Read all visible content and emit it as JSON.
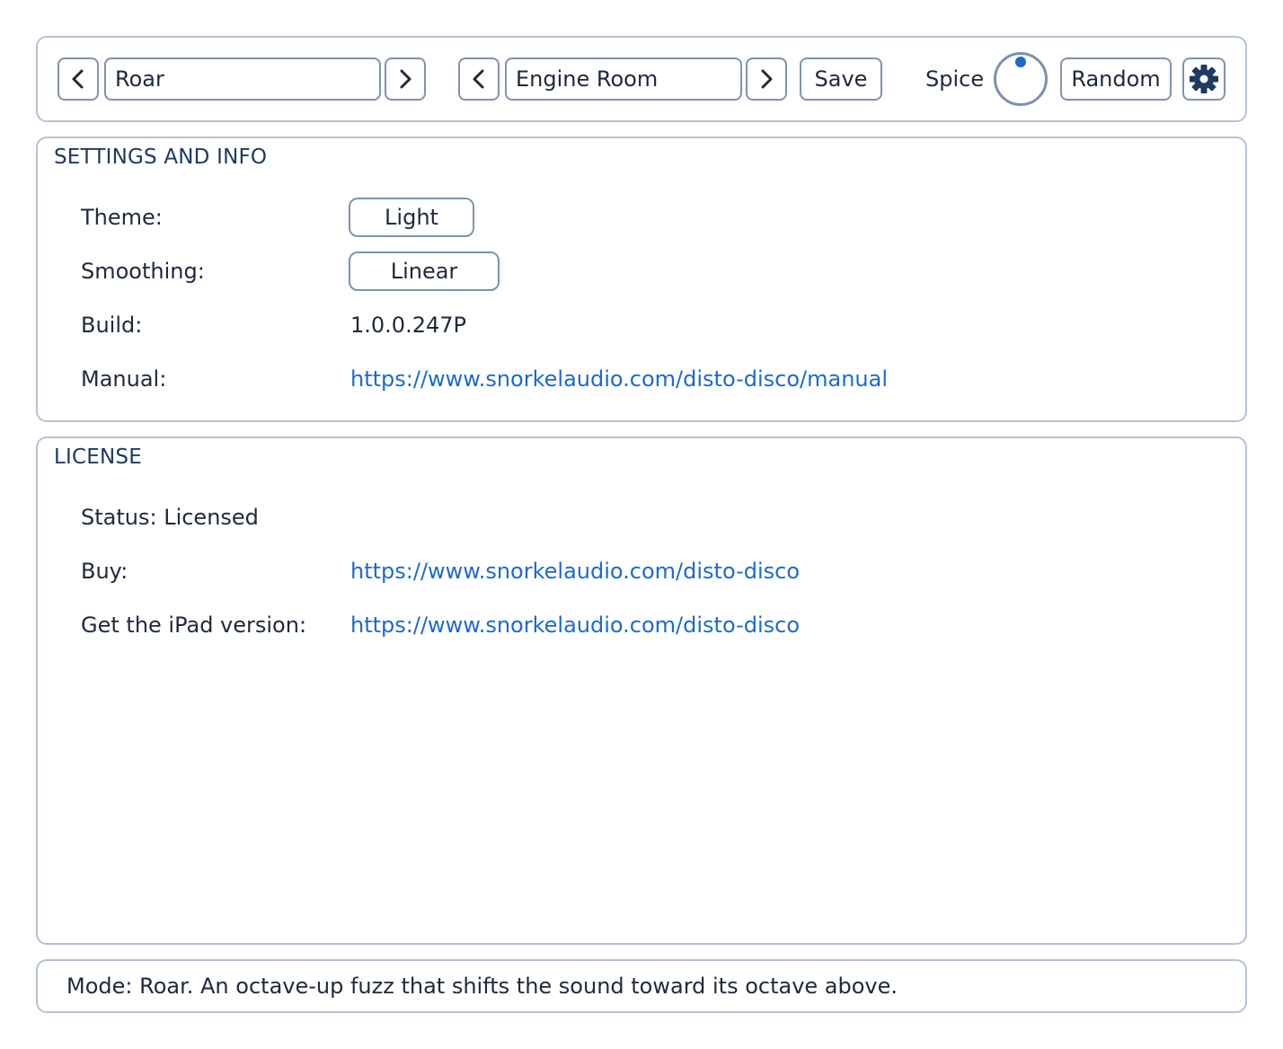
{
  "toolbar": {
    "mode_prev_icon": "chevron-left-icon",
    "mode_value": "Roar",
    "mode_next_icon": "chevron-right-icon",
    "preset_prev_icon": "chevron-left-icon",
    "preset_value": "Engine Room",
    "preset_next_icon": "chevron-right-icon",
    "save_label": "Save",
    "spice_label": "Spice",
    "random_label": "Random",
    "settings_icon": "gear-icon"
  },
  "settings": {
    "title": "SETTINGS AND INFO",
    "theme_label": "Theme:",
    "theme_value": "Light",
    "smoothing_label": "Smoothing:",
    "smoothing_value": "Linear",
    "build_label": "Build:",
    "build_value": "1.0.0.247P",
    "manual_label": "Manual:",
    "manual_link": "https://www.snorkelaudio.com/disto-disco/manual"
  },
  "license": {
    "title": "LICENSE",
    "status_text": "Status: Licensed",
    "buy_label": "Buy:",
    "buy_link": "https://www.snorkelaudio.com/disto-disco",
    "ipad_label": "Get the iPad version:",
    "ipad_link": "https://www.snorkelaudio.com/disto-disco"
  },
  "statusbar": {
    "text": "Mode: Roar. An octave-up fuzz that shifts the sound toward its octave above."
  },
  "colors": {
    "accent": "#1a6bd0",
    "border": "#b4c2d6",
    "control_border": "#8093ad",
    "text": "#1e2a3c"
  }
}
